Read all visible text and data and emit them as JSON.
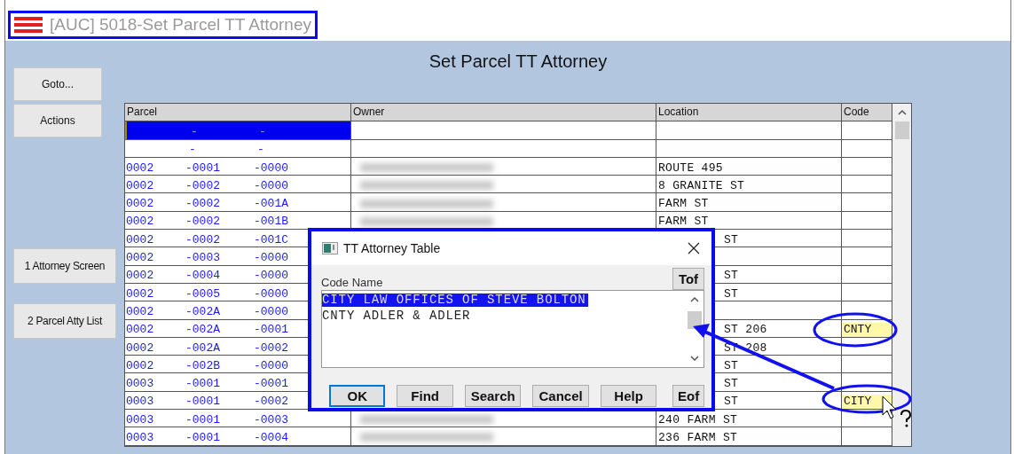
{
  "window": {
    "title": "[AUC] 5018-Set Parcel TT Attorney"
  },
  "heading": "Set Parcel TT Attorney",
  "top_buttons": [
    "Goto...",
    "Actions"
  ],
  "screen_buttons": [
    "1 Attorney Screen",
    "2 Parcel Atty List"
  ],
  "table": {
    "columns": [
      "Parcel",
      "Owner",
      "Location",
      "Code"
    ],
    "rows": [
      {
        "kind": "new",
        "parcel": [
          "-",
          "-"
        ],
        "selected": true,
        "covered": false
      },
      {
        "kind": "new",
        "parcel": [
          "-",
          "-"
        ],
        "selected": false,
        "covered": false
      },
      {
        "kind": "entry",
        "parcel": [
          "0002",
          "-0001",
          "-0000"
        ],
        "location": "ROUTE 495",
        "selected": false,
        "covered": false
      },
      {
        "kind": "entry",
        "parcel": [
          "0002",
          "-0002",
          "-0000"
        ],
        "location": "8 GRANITE ST",
        "selected": false,
        "covered": false
      },
      {
        "kind": "entry",
        "parcel": [
          "0002",
          "-0002",
          "-001A"
        ],
        "location": "FARM ST",
        "selected": false,
        "covered": false
      },
      {
        "kind": "entry",
        "parcel": [
          "0002",
          "-0002",
          "-001B"
        ],
        "location": "FARM ST",
        "selected": false,
        "covered": false
      },
      {
        "kind": "entry",
        "parcel": [
          "0002",
          "-0002",
          "-001C"
        ],
        "location": "ST",
        "selected": false,
        "covered": true
      },
      {
        "kind": "entry",
        "parcel": [
          "0002",
          "-0003",
          "-0000"
        ],
        "selected": false
      },
      {
        "kind": "entry",
        "parcel": [
          "0002",
          "-0004",
          "-0000"
        ],
        "location": "ST",
        "selected": false,
        "covered": true
      },
      {
        "kind": "entry",
        "parcel": [
          "0002",
          "-0005",
          "-0000"
        ],
        "location": "ST",
        "selected": false,
        "covered": true
      },
      {
        "kind": "entry",
        "parcel": [
          "0002",
          "-002A",
          "-0000"
        ],
        "selected": false
      },
      {
        "kind": "entry",
        "parcel": [
          "0002",
          "-002A",
          "-0001"
        ],
        "location": "ST 206",
        "code": "CNTY",
        "selected": false,
        "covered": true
      },
      {
        "kind": "entry",
        "parcel": [
          "0002",
          "-002A",
          "-0002"
        ],
        "location": "ST 208",
        "selected": false,
        "covered": true
      },
      {
        "kind": "entry",
        "parcel": [
          "0002",
          "-002B",
          "-0000"
        ],
        "location": "ST",
        "selected": false,
        "covered": true
      },
      {
        "kind": "entry",
        "parcel": [
          "0003",
          "-0001",
          "-0001"
        ],
        "location": "ST",
        "selected": false,
        "covered": true
      },
      {
        "kind": "entry",
        "parcel": [
          "0003",
          "-0001",
          "-0002"
        ],
        "location": "ST",
        "code": "CITY",
        "selected": false,
        "covered": true
      },
      {
        "kind": "entry",
        "parcel": [
          "0003",
          "-0001",
          "-0003"
        ],
        "location": "240 FARM ST",
        "selected": false,
        "covered": false
      },
      {
        "kind": "entry",
        "parcel": [
          "0003",
          "-0001",
          "-0004"
        ],
        "location": "236 FARM ST",
        "selected": false,
        "covered": false
      }
    ]
  },
  "dialog": {
    "title": "TT Attorney Table",
    "list_header": "Code Name",
    "top_button": "Tof",
    "end_button": "Eof",
    "items": [
      {
        "text": "CITY LAW OFFICES OF STEVE BOLTON",
        "selected": true
      },
      {
        "text": "CNTY ADLER & ADLER",
        "selected": false
      }
    ],
    "buttons": [
      {
        "label": "OK",
        "focused": true
      },
      {
        "label": "Find",
        "focused": false
      },
      {
        "label": "Search",
        "focused": false
      },
      {
        "label": "Cancel",
        "focused": false
      },
      {
        "label": "Help",
        "focused": false
      }
    ]
  }
}
